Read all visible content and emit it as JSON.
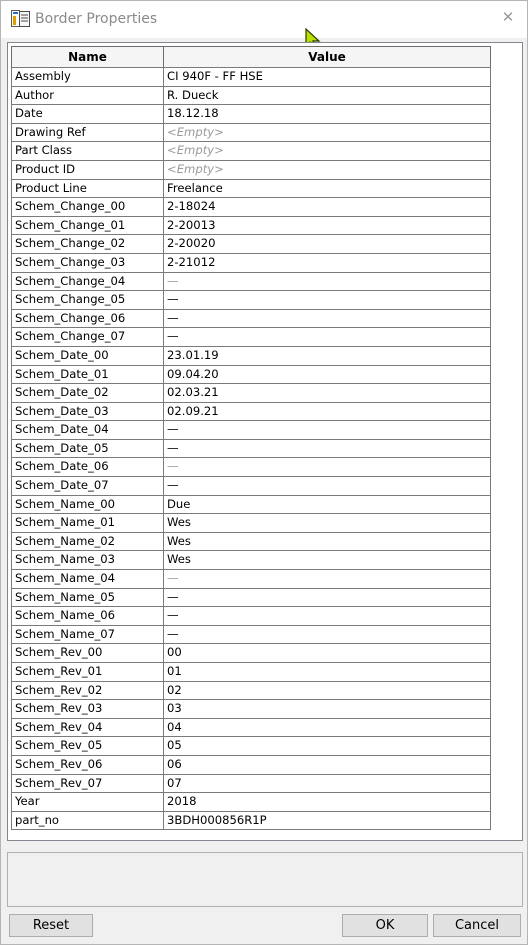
{
  "window": {
    "title": "Border Properties",
    "icon": "document-properties-icon",
    "close_glyph": "✕"
  },
  "grid": {
    "columns": [
      "Name",
      "Value"
    ],
    "rows": [
      {
        "name": "Assembly",
        "value": "CI 940F - FF HSE",
        "style": "normal"
      },
      {
        "name": "Author",
        "value": "R. Dueck",
        "style": "normal"
      },
      {
        "name": "Date",
        "value": "18.12.18",
        "style": "normal"
      },
      {
        "name": "Drawing Ref",
        "value": "<Empty>",
        "style": "empty"
      },
      {
        "name": "Part Class",
        "value": "<Empty>",
        "style": "empty"
      },
      {
        "name": "Product ID",
        "value": "<Empty>",
        "style": "empty"
      },
      {
        "name": "Product Line",
        "value": "Freelance",
        "style": "normal"
      },
      {
        "name": "Schem_Change_00",
        "value": "2-18024",
        "style": "normal"
      },
      {
        "name": "Schem_Change_01",
        "value": "2-20013",
        "style": "normal"
      },
      {
        "name": "Schem_Change_02",
        "value": "2-20020",
        "style": "normal"
      },
      {
        "name": "Schem_Change_03",
        "value": "2-21012",
        "style": "normal"
      },
      {
        "name": "Schem_Change_04",
        "value": "—",
        "style": "dash-light"
      },
      {
        "name": "Schem_Change_05",
        "value": "—",
        "style": "dash"
      },
      {
        "name": "Schem_Change_06",
        "value": "—",
        "style": "dash"
      },
      {
        "name": "Schem_Change_07",
        "value": "—",
        "style": "dash"
      },
      {
        "name": "Schem_Date_00",
        "value": "23.01.19",
        "style": "normal"
      },
      {
        "name": "Schem_Date_01",
        "value": "09.04.20",
        "style": "normal"
      },
      {
        "name": "Schem_Date_02",
        "value": "02.03.21",
        "style": "normal"
      },
      {
        "name": "Schem_Date_03",
        "value": "02.09.21",
        "style": "normal"
      },
      {
        "name": "Schem_Date_04",
        "value": "—",
        "style": "dash"
      },
      {
        "name": "Schem_Date_05",
        "value": "—",
        "style": "dash"
      },
      {
        "name": "Schem_Date_06",
        "value": "—",
        "style": "dash-light"
      },
      {
        "name": "Schem_Date_07",
        "value": "—",
        "style": "dash"
      },
      {
        "name": "Schem_Name_00",
        "value": "Due",
        "style": "normal"
      },
      {
        "name": "Schem_Name_01",
        "value": "Wes",
        "style": "normal"
      },
      {
        "name": "Schem_Name_02",
        "value": "Wes",
        "style": "normal"
      },
      {
        "name": "Schem_Name_03",
        "value": "Wes",
        "style": "normal"
      },
      {
        "name": "Schem_Name_04",
        "value": "—",
        "style": "dash-light"
      },
      {
        "name": "Schem_Name_05",
        "value": "—",
        "style": "dash"
      },
      {
        "name": "Schem_Name_06",
        "value": "—",
        "style": "dash"
      },
      {
        "name": "Schem_Name_07",
        "value": "—",
        "style": "dash"
      },
      {
        "name": "Schem_Rev_00",
        "value": "00",
        "style": "normal"
      },
      {
        "name": "Schem_Rev_01",
        "value": "01",
        "style": "normal"
      },
      {
        "name": "Schem_Rev_02",
        "value": "02",
        "style": "normal"
      },
      {
        "name": "Schem_Rev_03",
        "value": "03",
        "style": "normal"
      },
      {
        "name": "Schem_Rev_04",
        "value": "04",
        "style": "normal"
      },
      {
        "name": "Schem_Rev_05",
        "value": "05",
        "style": "normal"
      },
      {
        "name": "Schem_Rev_06",
        "value": "06",
        "style": "normal"
      },
      {
        "name": "Schem_Rev_07",
        "value": "07",
        "style": "normal"
      },
      {
        "name": "Year",
        "value": "2018",
        "style": "normal"
      },
      {
        "name": "part_no",
        "value": "3BDH000856R1P",
        "style": "normal"
      }
    ]
  },
  "description": "",
  "buttons": {
    "reset": "Reset",
    "ok": "OK",
    "cancel": "Cancel"
  }
}
